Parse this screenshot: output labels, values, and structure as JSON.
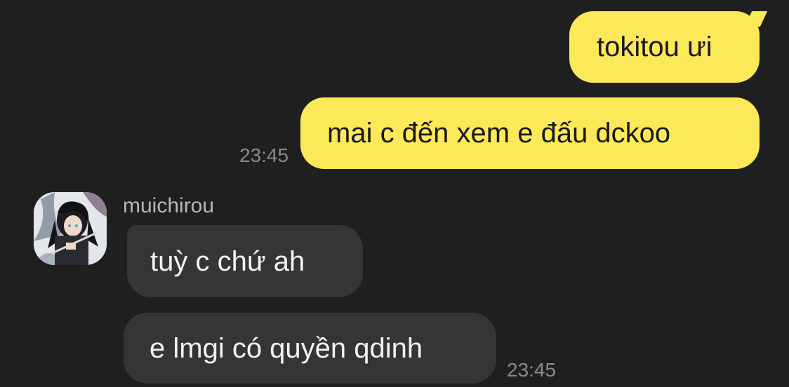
{
  "messages": [
    {
      "direction": "outgoing",
      "text": "tokitou ưi"
    },
    {
      "direction": "outgoing",
      "text": "mai c đến xem e đấu dckoo",
      "time": "23:45"
    },
    {
      "direction": "incoming",
      "sender": "muichirou",
      "text": "tuỳ c chứ ah"
    },
    {
      "direction": "incoming",
      "text": "e lmgi có quyền qdinh",
      "time": "23:45"
    }
  ],
  "colors": {
    "background": "#1f1f1f",
    "outgoing_bubble": "#fbe95a",
    "incoming_bubble": "#353535",
    "timestamp": "#8a8a8a",
    "sender_name": "#b7b7b7"
  },
  "icons": {
    "avatar": "contact-avatar-image"
  }
}
